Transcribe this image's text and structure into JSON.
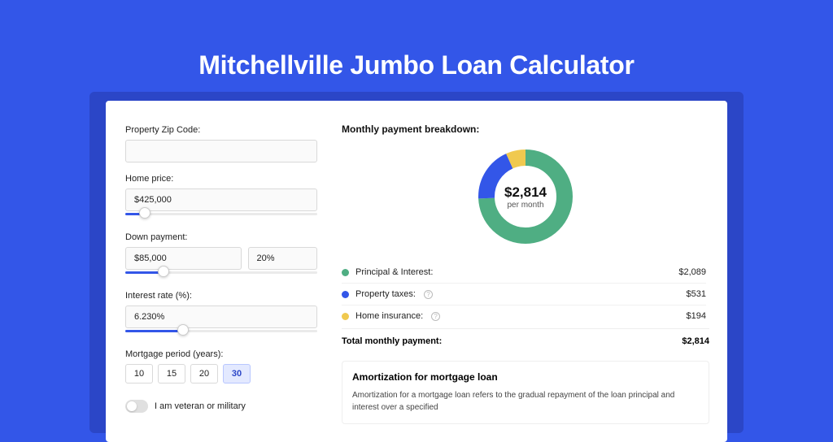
{
  "title": "Mitchellville Jumbo Loan Calculator",
  "colors": {
    "green": "#4fae83",
    "blue": "#3356e8",
    "yellow": "#f0c94f"
  },
  "form": {
    "zip": {
      "label": "Property Zip Code:",
      "value": ""
    },
    "price": {
      "label": "Home price:",
      "value": "$425,000",
      "slider_pct": 10
    },
    "down": {
      "label": "Down payment:",
      "value": "$85,000",
      "pct": "20%",
      "slider_pct": 20
    },
    "rate": {
      "label": "Interest rate (%):",
      "value": "6.230%",
      "slider_pct": 30
    },
    "period": {
      "label": "Mortgage period (years):",
      "options": [
        "10",
        "15",
        "20",
        "30"
      ],
      "selected": "30"
    },
    "veteran": {
      "label": "I am veteran or military",
      "on": false
    }
  },
  "breakdown": {
    "title": "Monthly payment breakdown:",
    "center_amount": "$2,814",
    "center_sub": "per month",
    "items": [
      {
        "label": "Principal & Interest:",
        "value": "$2,089",
        "color": "green",
        "info": false,
        "frac": 0.742
      },
      {
        "label": "Property taxes:",
        "value": "$531",
        "color": "blue",
        "info": true,
        "frac": 0.189
      },
      {
        "label": "Home insurance:",
        "value": "$194",
        "color": "yellow",
        "info": true,
        "frac": 0.069
      }
    ],
    "total_label": "Total monthly payment:",
    "total_value": "$2,814"
  },
  "amort": {
    "title": "Amortization for mortgage loan",
    "text": "Amortization for a mortgage loan refers to the gradual repayment of the loan principal and interest over a specified"
  },
  "chart_data": {
    "type": "pie",
    "title": "Monthly payment breakdown",
    "series": [
      {
        "name": "Principal & Interest",
        "value": 2089,
        "color": "#4fae83"
      },
      {
        "name": "Property taxes",
        "value": 531,
        "color": "#3356e8"
      },
      {
        "name": "Home insurance",
        "value": 194,
        "color": "#f0c94f"
      }
    ],
    "total": 2814,
    "center_label": "$2,814 per month"
  }
}
